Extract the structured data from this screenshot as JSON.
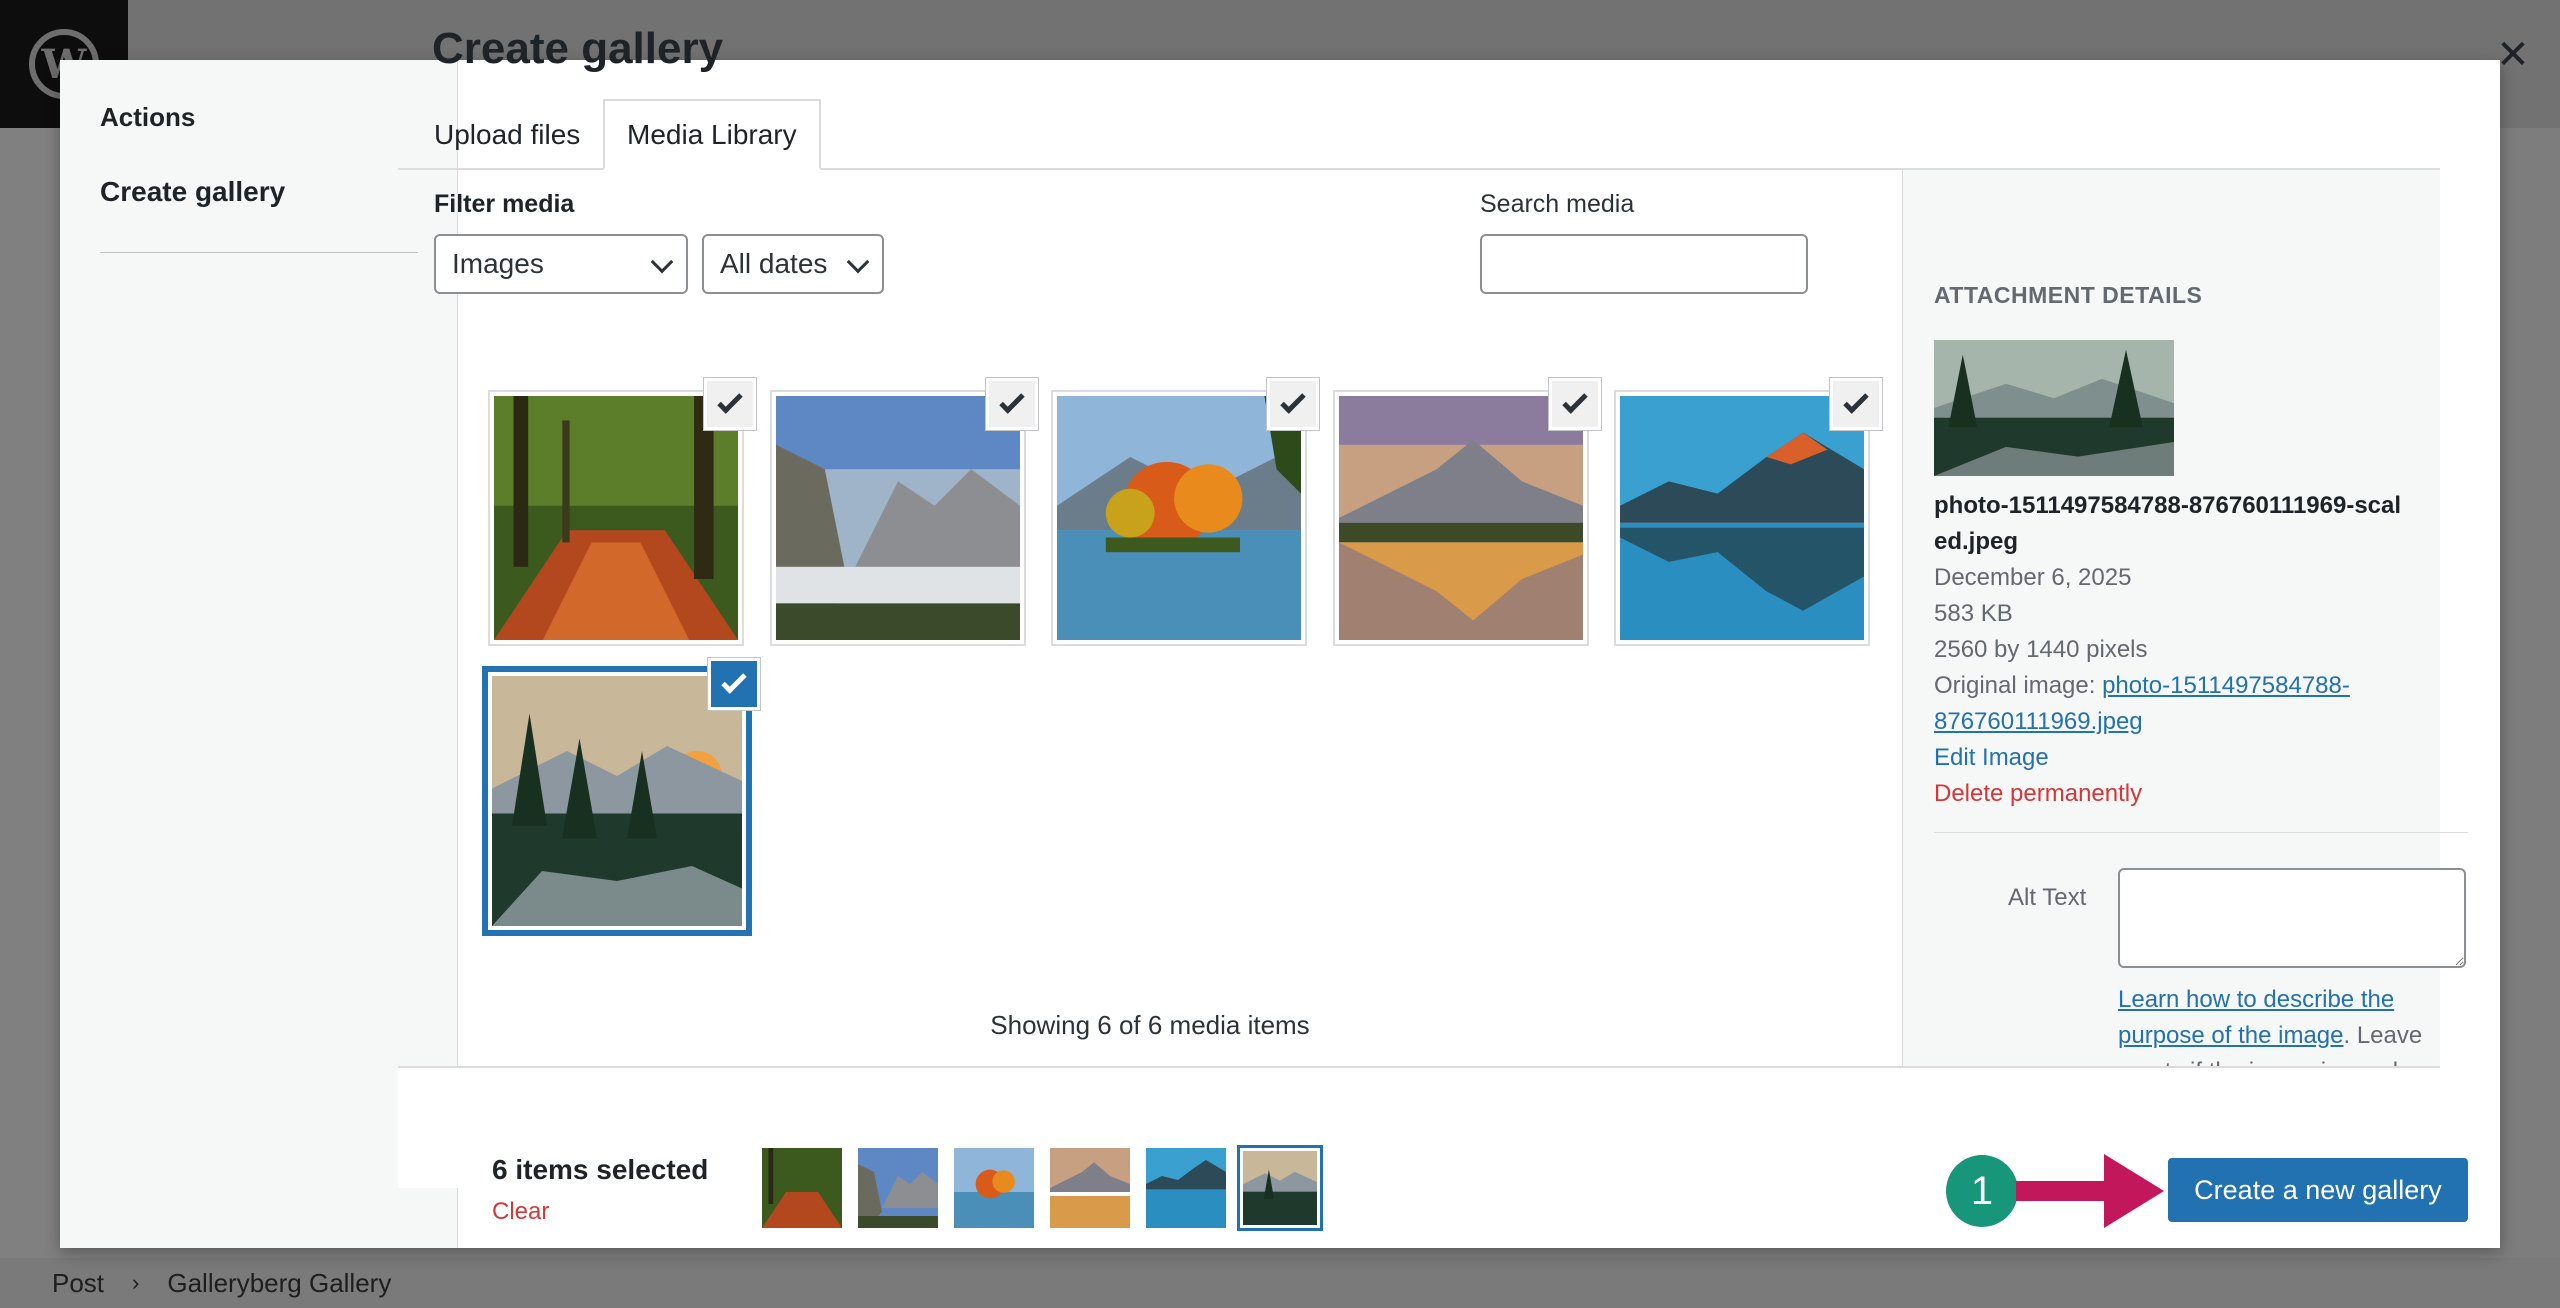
{
  "footer": {
    "crumb1": "Post",
    "crumb2": "Galleryberg Gallery"
  },
  "menu": {
    "heading": "Actions",
    "item": "Create gallery"
  },
  "frame": {
    "title": "Create gallery"
  },
  "tabs": [
    {
      "label": "Upload files"
    },
    {
      "label": "Media Library"
    }
  ],
  "filters": {
    "label": "Filter media",
    "type_selected": "Images",
    "date_selected": "All dates",
    "search_label": "Search media",
    "search_value": ""
  },
  "media": {
    "items": [
      {
        "name": "forest path autumn",
        "selected": true
      },
      {
        "name": "valley mountains mist",
        "selected": true
      },
      {
        "name": "autumn lake island",
        "selected": true
      },
      {
        "name": "mountain sunset lake reflection",
        "selected": true
      },
      {
        "name": "blue mountain lake reflection",
        "selected": true
      },
      {
        "name": "pine forest sunset mountains",
        "selected": true,
        "active": true
      }
    ],
    "showing": "Showing 6 of 6 media items"
  },
  "details": {
    "title": "ATTACHMENT DETAILS",
    "filename": "photo-1511497584788-876760111969-scaled.jpeg",
    "date": "December 6, 2025",
    "size": "583 KB",
    "dimensions": "2560 by 1440 pixels",
    "original_label": "Original image:",
    "original_link": "photo-1511497584788-876760111969.jpeg",
    "edit": "Edit Image",
    "delete": "Delete permanently",
    "alt_label": "Alt Text",
    "alt_value": "",
    "help_link": "Learn how to describe the purpose of the image",
    "help_rest": ". Leave empty if the image is purely decorative."
  },
  "toolbar": {
    "count": "6 items selected",
    "clear": "Clear",
    "callout": "1",
    "create": "Create a new gallery"
  },
  "colors": {
    "accent": "#2271b1",
    "danger": "#d63638",
    "callout": "#17967a",
    "arrow": "#c2185b"
  }
}
